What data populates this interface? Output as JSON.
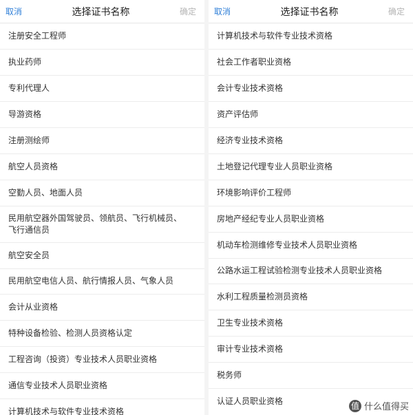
{
  "left_panel": {
    "header": {
      "cancel_label": "取消",
      "title": "选择证书名称",
      "confirm_label": "确定"
    },
    "items": [
      "注册安全工程师",
      "执业药师",
      "专利代理人",
      "导游资格",
      "注册测绘师",
      "航空人员资格",
      "空勤人员、地面人员",
      "民用航空器外国驾驶员、领航员、飞行机械员、飞行通信员",
      "航空安全员",
      "民用航空电信人员、航行情报人员、气象人员",
      "会计从业资格",
      "特种设备检验、检测人员资格认定",
      "工程咨询（投资）专业技术人员职业资格",
      "通信专业技术人员职业资格",
      "计算机技术与软件专业技术资格"
    ]
  },
  "right_panel": {
    "header": {
      "cancel_label": "取消",
      "title": "选择证书名称",
      "confirm_label": "确定"
    },
    "items": [
      "计算机技术与软件专业技术资格",
      "社会工作者职业资格",
      "会计专业技术资格",
      "资产评估师",
      "经济专业技术资格",
      "土地登记代理专业人员职业资格",
      "环境影响评价工程师",
      "房地产经纪专业人员职业资格",
      "机动车检测维修专业技术人员职业资格",
      "公路水运工程试验检测专业技术人员职业资格",
      "水利工程质量检测员资格",
      "卫生专业技术资格",
      "审计专业技术资格",
      "税务师",
      "认证人员职业资格"
    ]
  },
  "watermark": {
    "logo": "值",
    "text": "什么值得买"
  },
  "colors": {
    "accent": "#2f7fd8",
    "disabled": "#b5b5b5",
    "divider": "#ececec"
  }
}
